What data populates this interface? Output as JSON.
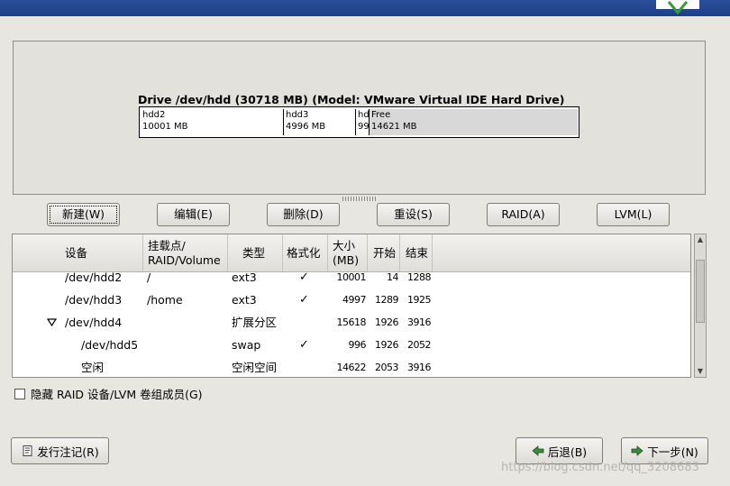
{
  "drive": {
    "title": "Drive /dev/hdd (30718 MB) (Model: VMware Virtual IDE Hard Drive)",
    "segments": [
      {
        "name": "hdd2",
        "size": "10001 MB"
      },
      {
        "name": "hdd3",
        "size": "4996 MB"
      },
      {
        "name": "hd",
        "size": "99"
      },
      {
        "name": "Free",
        "size": "14621 MB"
      }
    ]
  },
  "actions": {
    "new": "新建(W)",
    "edit": "编辑(E)",
    "delete": "删除(D)",
    "reset": "重设(S)",
    "raid": "RAID(A)",
    "lvm": "LVM(L)"
  },
  "table": {
    "headers": {
      "device": "设备",
      "mount1": "挂载点/",
      "mount2": "RAID/Volume",
      "type": "类型",
      "format": "格式化",
      "size1": "大小",
      "size2": "(MB)",
      "start": "开始",
      "end": "结束"
    },
    "rows": [
      {
        "device": "/dev/hdd2",
        "mount": "/",
        "type": "ext3",
        "format": "✓",
        "size": "10001",
        "start": "14",
        "end": "1288"
      },
      {
        "device": "/dev/hdd3",
        "mount": "/home",
        "type": "ext3",
        "format": "✓",
        "size": "4997",
        "start": "1289",
        "end": "1925"
      },
      {
        "device": "/dev/hdd4",
        "mount": "",
        "type": "扩展分区",
        "format": "",
        "size": "15618",
        "start": "1926",
        "end": "3916"
      },
      {
        "device": "/dev/hdd5",
        "mount": "",
        "type": "swap",
        "format": "✓",
        "size": "996",
        "start": "1926",
        "end": "2052"
      },
      {
        "device": "空闲",
        "mount": "",
        "type": "空闲空间",
        "format": "",
        "size": "14622",
        "start": "2053",
        "end": "3916"
      }
    ]
  },
  "options": {
    "hide_raid": "隐藏 RAID 设备/LVM 卷组成员(G)"
  },
  "bottom": {
    "release_notes": "发行注记(R)",
    "back": "后退(B)",
    "next": "下一步(N)"
  },
  "watermark": "https://blog.csdn.net/qq_3208683"
}
